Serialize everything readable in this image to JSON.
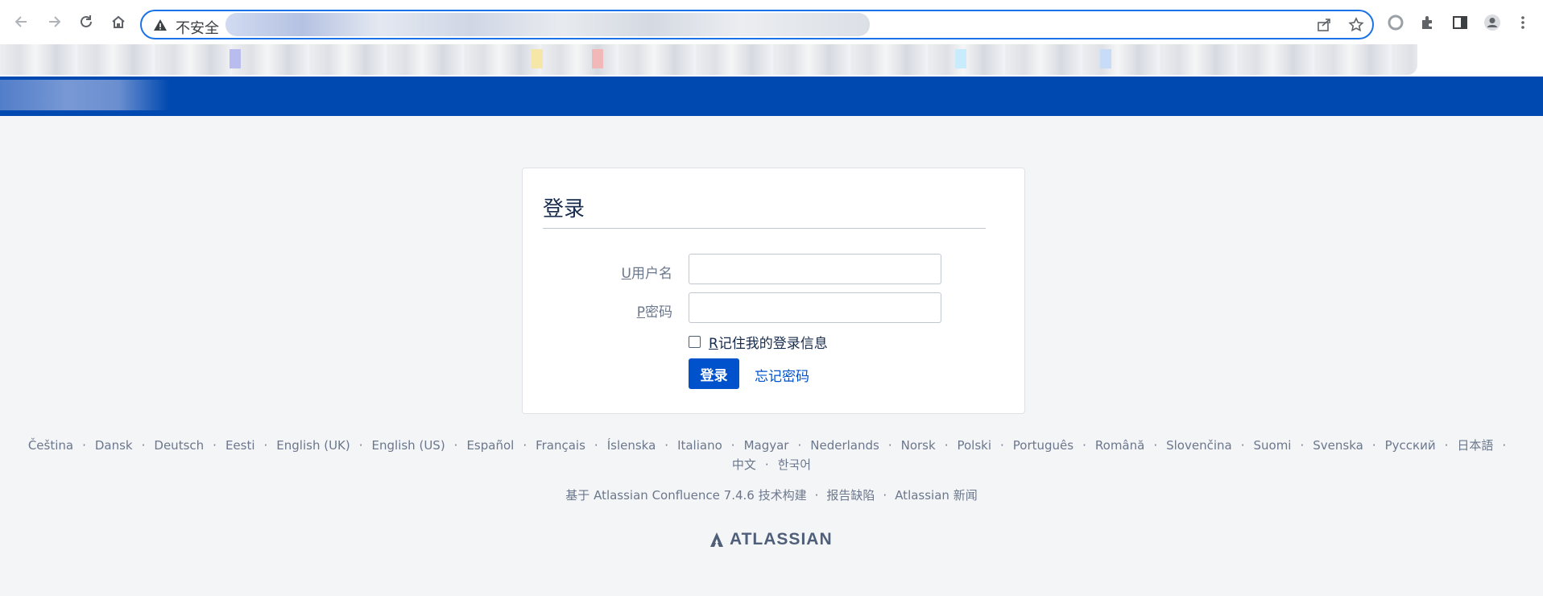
{
  "browser": {
    "security_label": "不安全",
    "url": ""
  },
  "login": {
    "title": "登录",
    "username_label_key": "U",
    "username_label": "用户名",
    "password_label_key": "P",
    "password_label": "密码",
    "username_value": "",
    "password_value": "",
    "remember_key": "R",
    "remember_label": "记住我的登录信息",
    "submit_label": "登录",
    "forgot_label": "忘记密码"
  },
  "languages": [
    "Čeština",
    "Dansk",
    "Deutsch",
    "Eesti",
    "English (UK)",
    "English (US)",
    "Español",
    "Français",
    "Íslenska",
    "Italiano",
    "Magyar",
    "Nederlands",
    "Norsk",
    "Polski",
    "Português",
    "Română",
    "Slovenčina",
    "Suomi",
    "Svenska",
    "Русский",
    "日本語",
    "中文",
    "한국어"
  ],
  "language_separator": "·",
  "footer": {
    "powered_by": "基于 Atlassian Confluence 7.4.6 技术构建",
    "report_bug": "报告缺陷",
    "news": "Atlassian 新闻",
    "separator": "·"
  },
  "brand": {
    "name": "ATLASSIAN"
  },
  "colors": {
    "header_blue": "#0049b0",
    "primary_button": "#0052cc",
    "link": "#0052cc",
    "page_bg": "#f4f5f7"
  }
}
